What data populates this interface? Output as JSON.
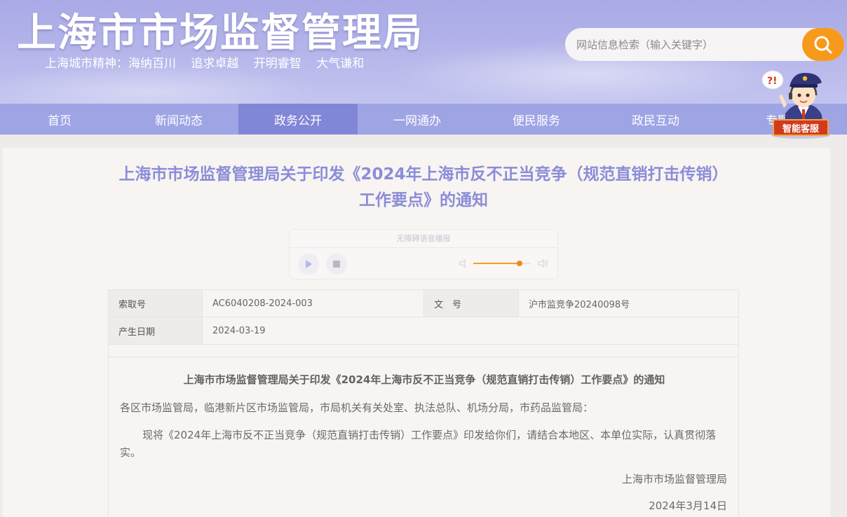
{
  "header": {
    "site_title": "上海市市场监督管理局",
    "slogan": [
      "上海城市精神：海纳百川",
      "追求卓越",
      "开明睿智",
      "大气谦和"
    ],
    "search_placeholder": "网站信息检索（输入关键字）",
    "search_icon": "magnifier-icon"
  },
  "nav": {
    "items": [
      "首页",
      "新闻动态",
      "政务公开",
      "一网通办",
      "便民服务",
      "政民互动",
      "专题"
    ],
    "active": "政务公开"
  },
  "assistant": {
    "label": "智能客服",
    "icon": "robot-officer-icon"
  },
  "article": {
    "title_line1": "上海市市场监督管理局关于印发《2024年上海市反不正当竞争（规范直销打击传销）",
    "title_line2": "工作要点》的通知"
  },
  "audio_player": {
    "title": "无障碍语音播报",
    "volume": 0.8,
    "accent": "#f3a118"
  },
  "meta": {
    "index_label": "索取号",
    "index_value": "AC6040208-2024-003",
    "doc_no_label": "文　号",
    "doc_no_value": "沪市监竞争20240098号",
    "date_label": "产生日期",
    "date_value": "2024-03-19"
  },
  "doc": {
    "title": "上海市市场监督管理局关于印发《2024年上海市反不正当竞争（规范直销打击传销）工作要点》的通知",
    "addressee": "各区市场监管局，临港新片区市场监管局，市局机关有关处室、执法总队、机场分局，市药品监管局：",
    "body": "现将《2024年上海市反不正当竞争（规范直销打击传销）工作要点》印发给你们，请结合本地区、本单位实际，认真贯彻落实。",
    "sign_org": "上海市市场监督管理局",
    "sign_date": "2024年3月14日"
  },
  "colors": {
    "header_bg": "#b4b4ea",
    "nav_bg": "#9ea4e4",
    "nav_active": "#8186d7",
    "title_color": "#8a8dd8",
    "search_btn": "#f79a1c"
  }
}
